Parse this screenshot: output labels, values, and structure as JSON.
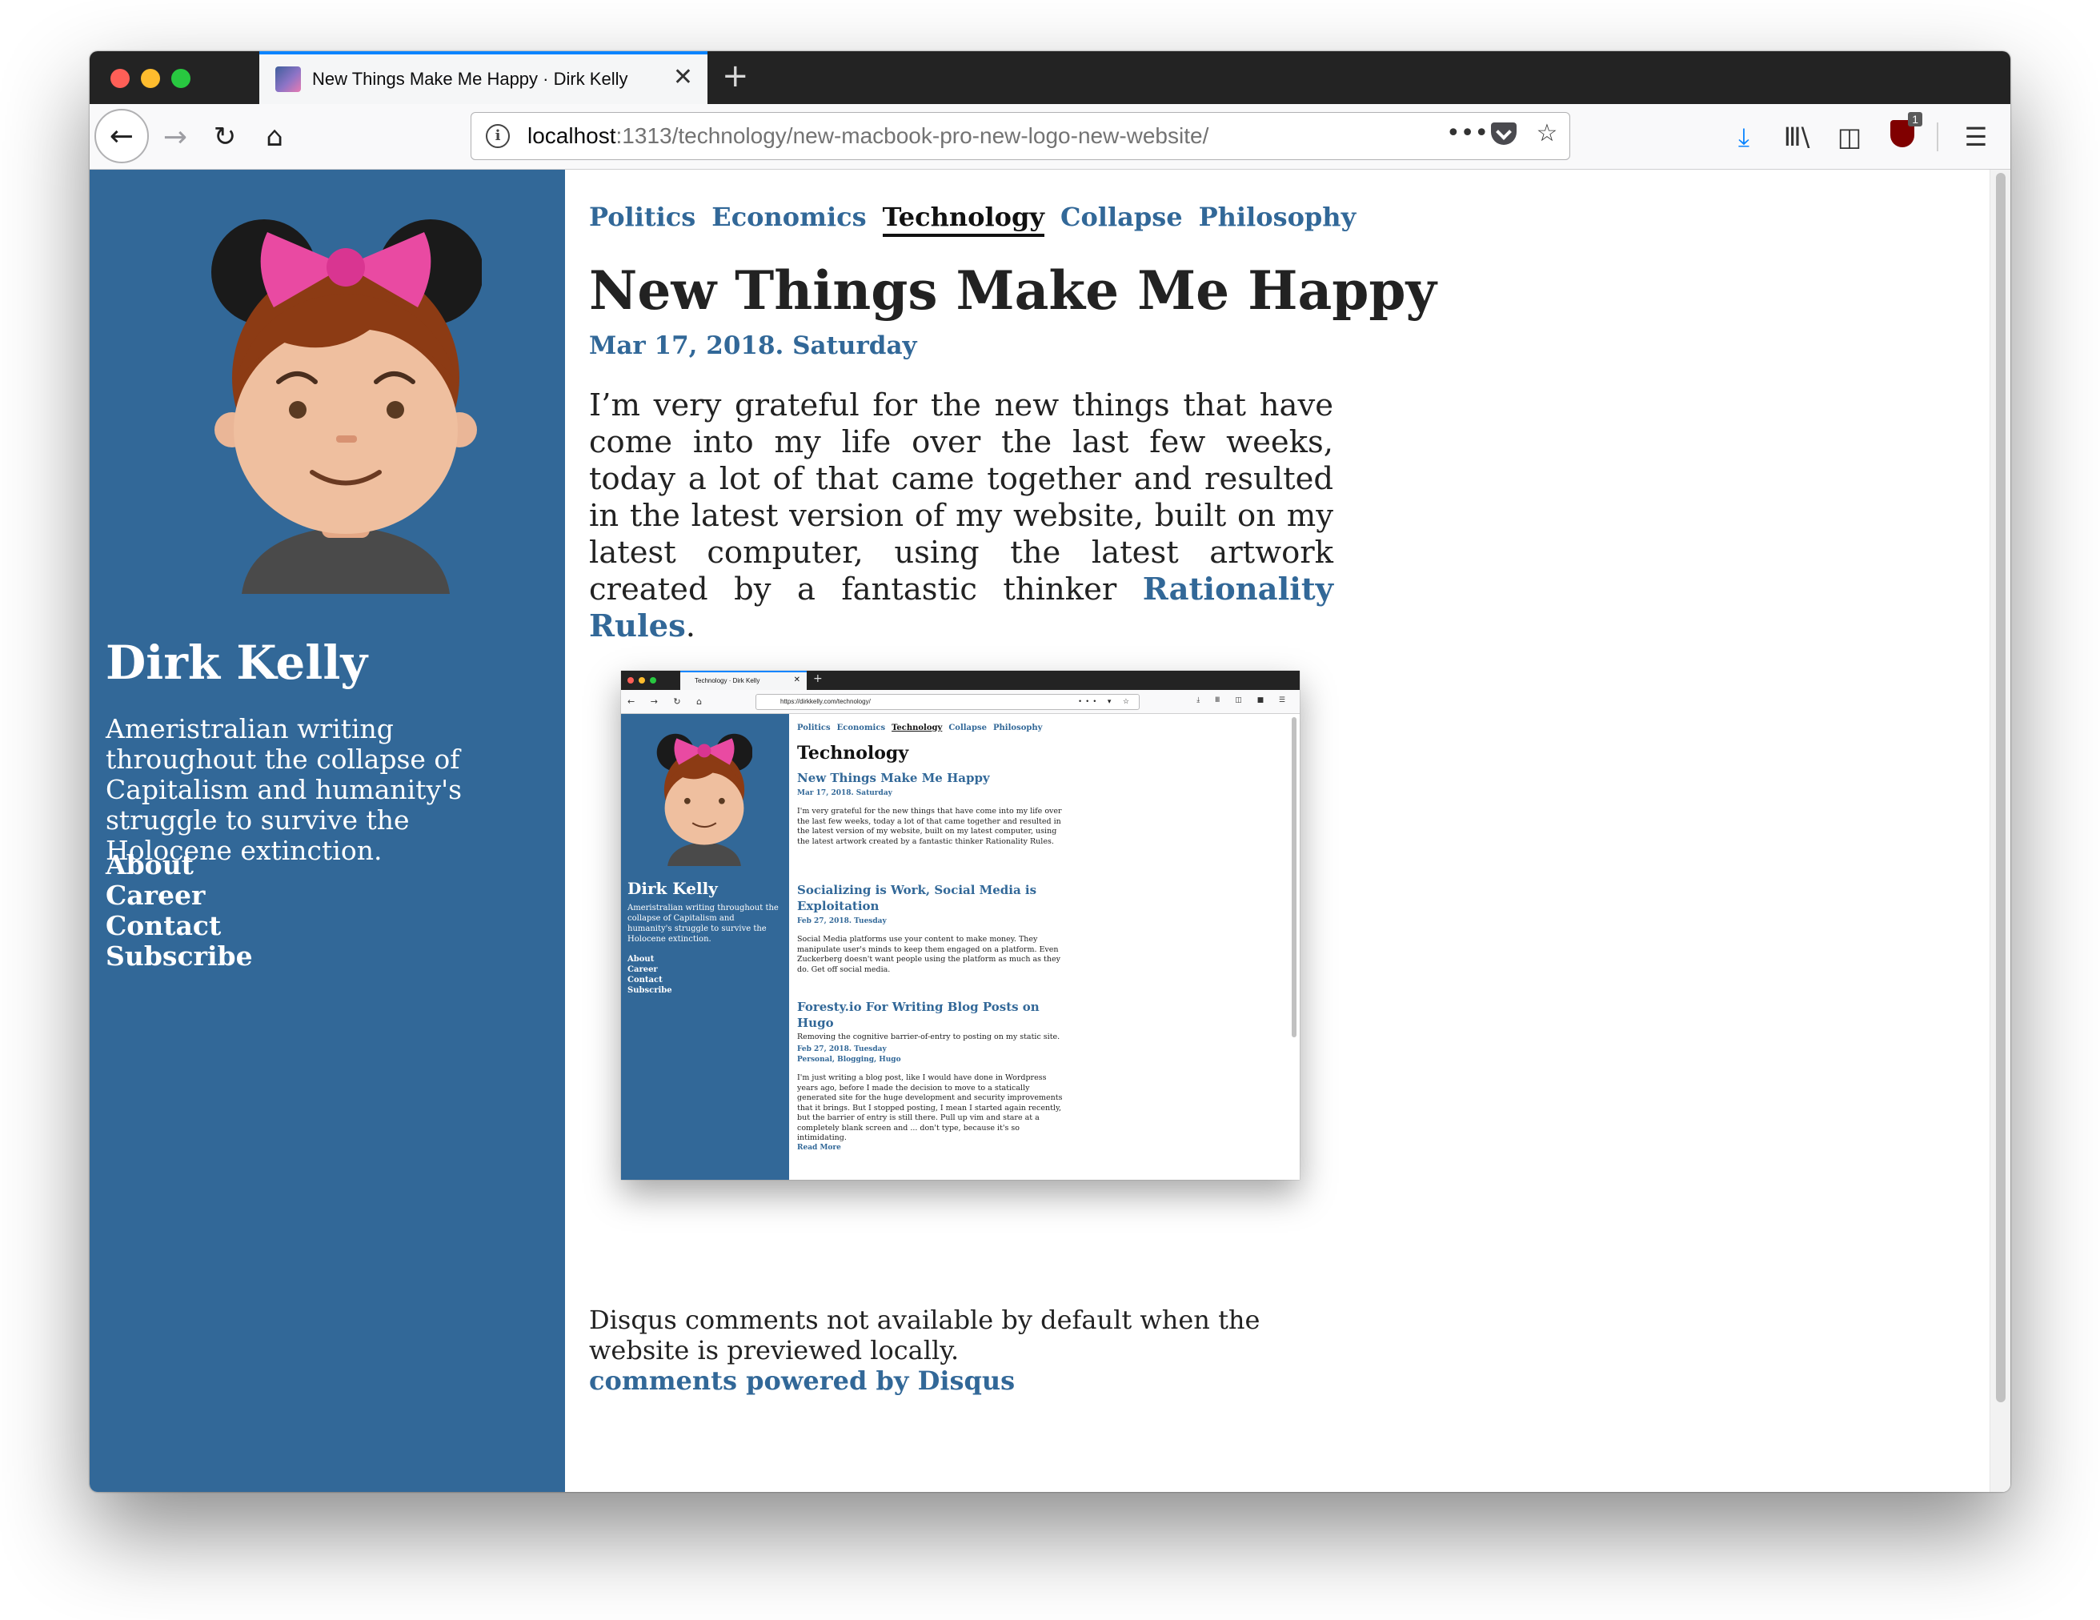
{
  "browser": {
    "tab_title": "New Things Make Me Happy · Dirk Kelly",
    "new_tab_label": "+",
    "url_host": "localhost",
    "url_path": ":1313/technology/new-macbook-pro-new-logo-new-website/",
    "toolbar_badge": "1"
  },
  "sidebar": {
    "author": "Dirk Kelly",
    "tagline": "Ameristralian writing throughout the collapse of Capitalism and humanity's struggle to survive the Holocene extinction.",
    "links": [
      "About",
      "Career",
      "Contact",
      "Subscribe"
    ]
  },
  "categories": [
    "Politics",
    "Economics",
    "Technology",
    "Collapse",
    "Philosophy"
  ],
  "active_category": "Technology",
  "post": {
    "title": "New Things Make Me Happy",
    "date": "Mar 17, 2018. Saturday",
    "body": "I’m very grateful for the new things that have come into my life over the last few weeks, today a lot of that came together and resulted in the latest version of my website, built on my latest computer, using the latest artwork created by a fantastic thinker ",
    "body_link": "Rationality Rules",
    "body_end": "."
  },
  "comments": {
    "note": "Disqus comments not available by default when the website is previewed locally.",
    "link": "comments powered by Disqus"
  },
  "screenshot": {
    "tab_title": "Technology · Dirk Kelly",
    "url": "https://dirkkelly.com/technology/",
    "heading": "Technology",
    "posts": [
      {
        "title": "New Things Make Me Happy",
        "date": "Mar 17, 2018. Saturday",
        "body": "I'm very grateful for the new things that have come into my life over the last few weeks, today a lot of that came together and resulted in the latest version of my website, built on my latest computer, using the latest artwork created by a fantastic thinker Rationality Rules."
      },
      {
        "title": "Socializing is Work, Social Media is Exploitation",
        "date": "Feb 27, 2018. Tuesday",
        "body": "Social Media platforms use your content to make money. They manipulate user's minds to keep them engaged on a platform. Even Zuckerberg doesn't want people using the platform as much as they do. Get off social media."
      },
      {
        "title": "Foresty.io For Writing Blog Posts on Hugo",
        "subtitle": "Removing the cognitive barrier-of-entry to posting on my static site.",
        "date": "Feb 27, 2018. Tuesday",
        "tags": "Personal, Blogging, Hugo",
        "body": "I'm just writing a blog post, like I would have done in Wordpress years ago, before I made the decision to move to a statically generated site for the huge development and security improvements that it brings. But I stopped posting, I mean I started again recently, but the barrier of entry is still there. Pull up vim and stare at a completely blank screen and ... don't type, because it's so intimidating.",
        "more": "Read More"
      }
    ]
  },
  "colors": {
    "sidebar": "#326898",
    "link": "#326898",
    "tab_accent": "#0a84ff"
  }
}
